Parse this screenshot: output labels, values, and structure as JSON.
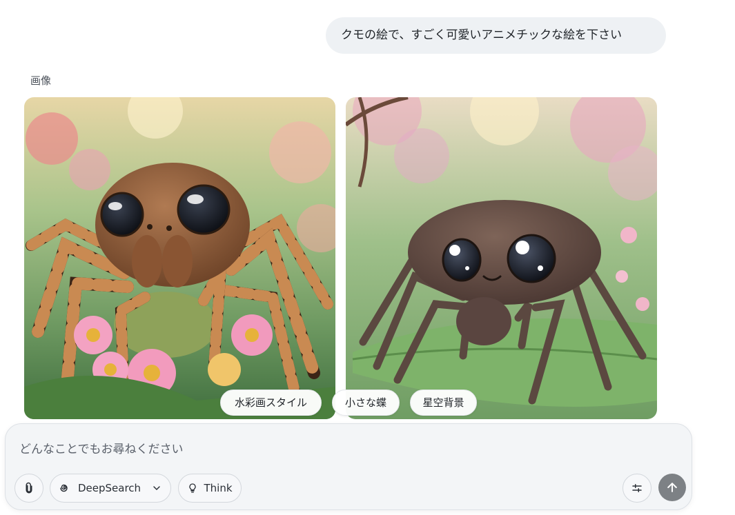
{
  "user_message": "クモの絵で、すごく可愛いアニメチックな絵を下さい",
  "section_label": "画像",
  "suggestions": [
    "水彩画スタイル",
    "小さな蝶",
    "星空背景"
  ],
  "composer": {
    "placeholder": "どんなことでもお尋ねください",
    "deepsearch_label": "DeepSearch",
    "think_label": "Think"
  },
  "icons": {
    "attach": "paperclip-icon",
    "deepsearch": "spiral-search-icon",
    "dropdown": "chevron-down-icon",
    "think": "lightbulb-icon",
    "settings": "sliders-icon",
    "send": "arrow-up-icon"
  },
  "colors": {
    "bubble_bg": "#eef1f4",
    "send_button": "#7d8185",
    "composer_bg": "#f3f5f7"
  }
}
